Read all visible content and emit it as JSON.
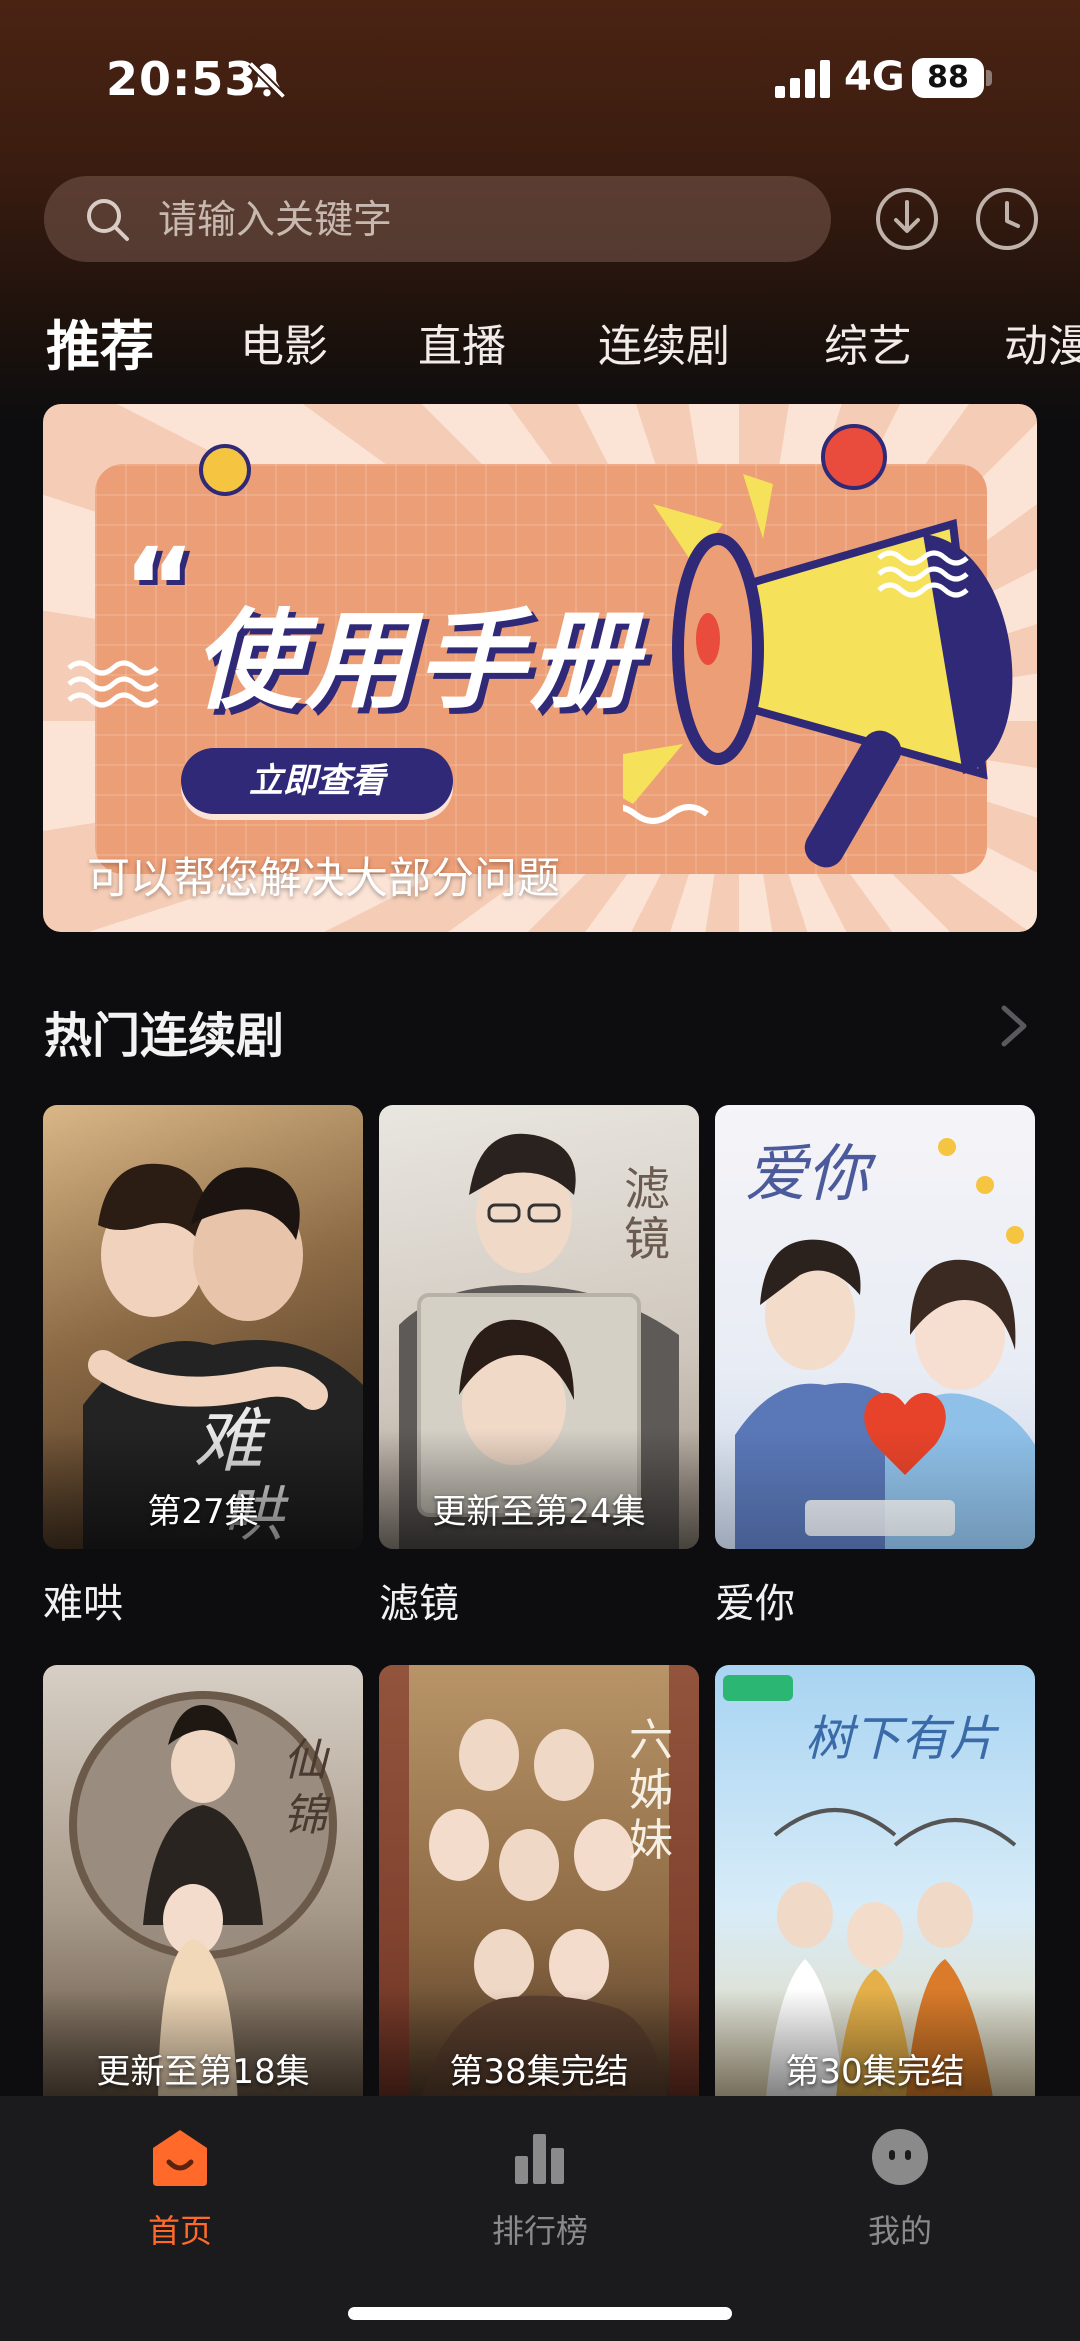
{
  "status_bar": {
    "time": "20:53",
    "network": "4G",
    "battery": "88"
  },
  "search": {
    "placeholder": "请输入关键字"
  },
  "tabs": [
    {
      "label": "推荐",
      "active": true
    },
    {
      "label": "电影"
    },
    {
      "label": "直播"
    },
    {
      "label": "连续剧"
    },
    {
      "label": "综艺"
    },
    {
      "label": "动漫"
    }
  ],
  "banner": {
    "quote_mark": "“",
    "title": "使用手册",
    "button_label": "立即查看",
    "caption": "可以帮您解决大部分问题"
  },
  "section": {
    "title": "热门连续剧"
  },
  "cards": [
    {
      "title": "难哄",
      "status": "第27集"
    },
    {
      "title": "滤镜",
      "status": "更新至第24集"
    },
    {
      "title": "爱你",
      "status": ""
    },
    {
      "title": "",
      "status": "更新至第18集"
    },
    {
      "title": "",
      "status": "第38集完结"
    },
    {
      "title": "",
      "status": "第30集完结"
    }
  ],
  "bottom_nav": [
    {
      "label": "首页",
      "icon": "home-icon",
      "active": true
    },
    {
      "label": "排行榜",
      "icon": "ranking-icon"
    },
    {
      "label": "我的",
      "icon": "profile-icon"
    }
  ],
  "colors": {
    "accent": "#ff6a2a",
    "nav_inactive": "#8a8a8a"
  }
}
